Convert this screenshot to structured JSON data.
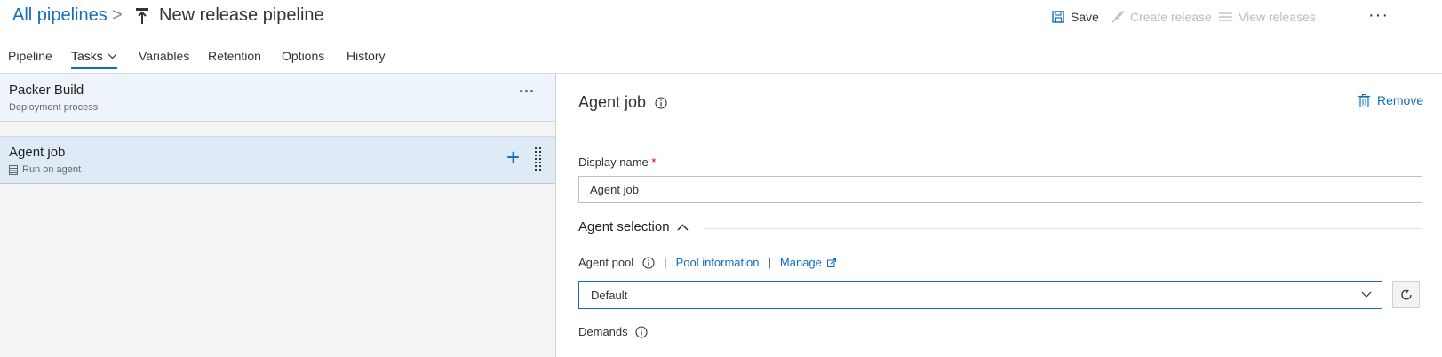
{
  "header": {
    "breadcrumb": "All pipelines",
    "separator": ">",
    "title": "New release pipeline",
    "save_label": "Save",
    "create_release_label": "Create release",
    "view_releases_label": "View releases",
    "more_label": "···"
  },
  "tabs": [
    {
      "label": "Pipeline"
    },
    {
      "label": "Tasks"
    },
    {
      "label": "Variables"
    },
    {
      "label": "Retention"
    },
    {
      "label": "Options"
    },
    {
      "label": "History"
    }
  ],
  "stage": {
    "title": "Packer Build",
    "subtitle": "Deployment process",
    "more_label": "···"
  },
  "job": {
    "title": "Agent job",
    "subtitle": "Run on agent",
    "add_label": "+"
  },
  "panel": {
    "title": "Agent job",
    "remove_label": "Remove",
    "display_name_label": "Display name",
    "required_mark": "*",
    "display_name_value": "Agent job",
    "agent_selection_label": "Agent selection",
    "agent_pool_label": "Agent pool",
    "pool_information_label": "Pool information",
    "manage_label": "Manage",
    "agent_pool_value": "Default",
    "demands_label": "Demands"
  },
  "colors": {
    "accent": "#106ebe",
    "disabled": "#bbbbbb",
    "job_selected": "#deebf7"
  }
}
